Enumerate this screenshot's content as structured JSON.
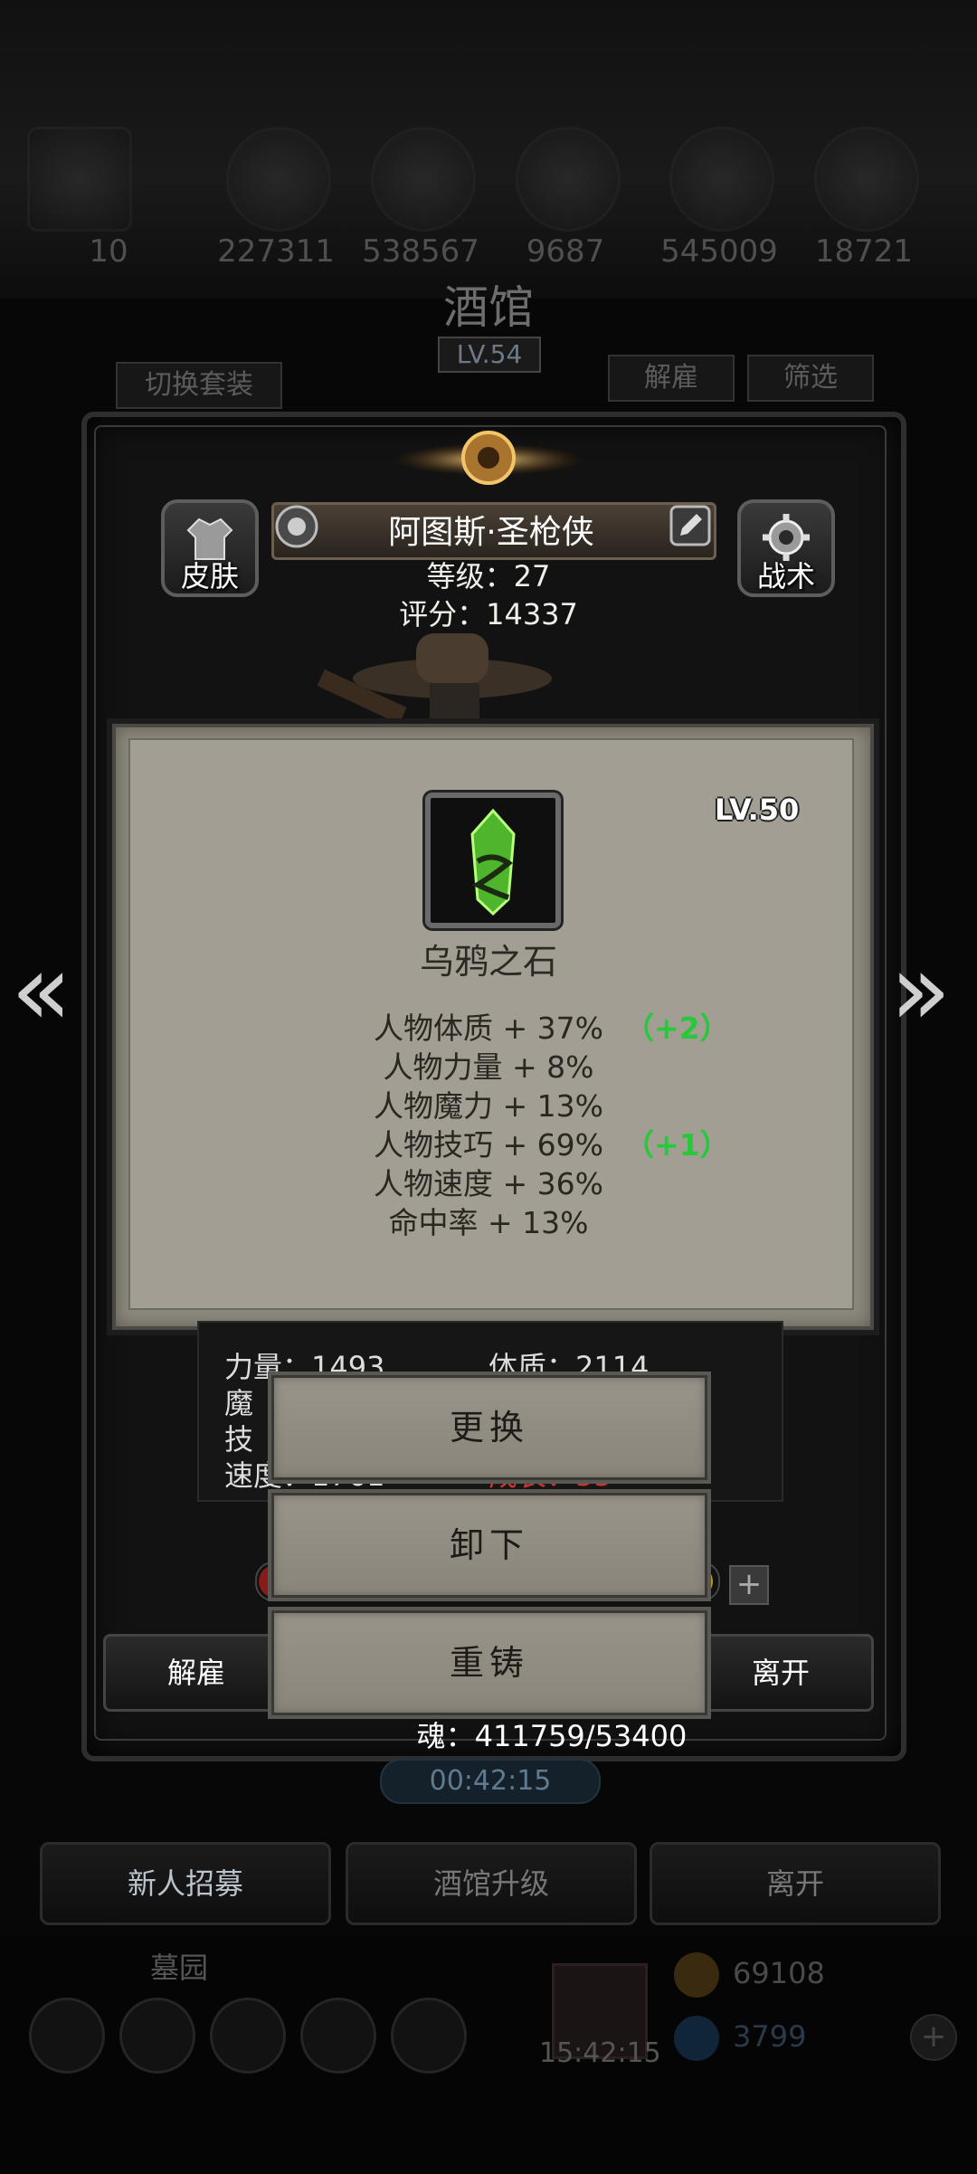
{
  "header": {
    "resources": [
      "10",
      "227311",
      "538567",
      "9687",
      "545009",
      "18721"
    ],
    "tavern_title": "酒馆",
    "tavern_level": "LV.54",
    "switch_outfit_label": "切换套装",
    "dismiss_label": "解雇",
    "filter_label": "筛选"
  },
  "hero": {
    "skin_label": "皮肤",
    "tactics_label": "战术",
    "name": "阿图斯·圣枪侠",
    "level_line": "等级：27",
    "score_line": "评分：14337"
  },
  "item_card": {
    "level": "LV.50",
    "name": "乌鸦之石",
    "attributes": [
      {
        "text": "人物体质 + 37%",
        "bonus": "（+2）"
      },
      {
        "text": "人物力量 + 8%",
        "bonus": ""
      },
      {
        "text": "人物魔力 + 13%",
        "bonus": ""
      },
      {
        "text": "人物技巧 + 69%",
        "bonus": "（+1）"
      },
      {
        "text": "人物速度 + 36%",
        "bonus": ""
      },
      {
        "text": "命中率 + 13%",
        "bonus": ""
      }
    ],
    "gem_color": "#5fd13a"
  },
  "stats_partial": {
    "str": "力量：1493",
    "con": "体质：2114",
    "mag": "魔",
    "skl": "技",
    "spd": "速度：1761",
    "growth": "成长：55"
  },
  "actions": {
    "replace": "更换",
    "unequip": "卸下",
    "reforge": "重铸"
  },
  "bottom": {
    "dismiss": "解雇",
    "leave": "离开",
    "soul": "魂：411759/53400",
    "timer": "00:42:15",
    "recruit": "新人招募",
    "upgrade": "酒馆升级",
    "leave_nav": "离开",
    "cemetery": "墓园",
    "gift_timer": "15:42:15",
    "gold": "69108",
    "gems": "3799"
  }
}
